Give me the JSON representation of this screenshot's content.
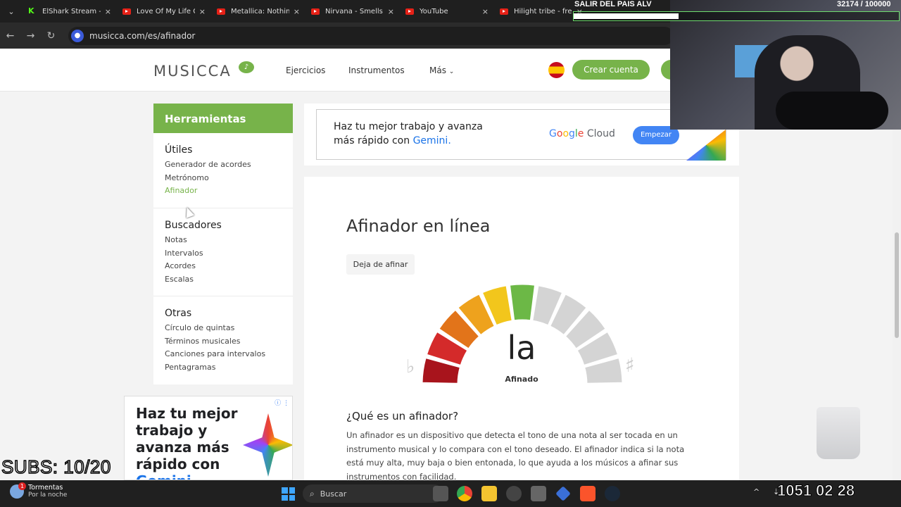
{
  "browser": {
    "tabs": [
      {
        "title": "ElShark Stream - V",
        "icon": "kick-icon"
      },
      {
        "title": "Love Of My Life G",
        "icon": "youtube-icon"
      },
      {
        "title": "Metallica: Nothing",
        "icon": "youtube-icon"
      },
      {
        "title": "Nirvana - Smells L",
        "icon": "youtube-icon"
      },
      {
        "title": "YouTube",
        "icon": "youtube-icon"
      },
      {
        "title": "Hilight tribe - free",
        "icon": "youtube-icon"
      }
    ],
    "url": "musicca.com/es/afinador"
  },
  "header": {
    "logo": "MUSICCA",
    "nav": [
      "Ejercicios",
      "Instrumentos",
      "Más"
    ],
    "create_account": "Crear cuenta"
  },
  "sidebar": {
    "title": "Herramientas",
    "sections": [
      {
        "heading": "Útiles",
        "items": [
          "Generador de acordes",
          "Metrónomo",
          "Afinador"
        ]
      },
      {
        "heading": "Buscadores",
        "items": [
          "Notas",
          "Intervalos",
          "Acordes",
          "Escalas"
        ]
      },
      {
        "heading": "Otras",
        "items": [
          "Círculo de quintas",
          "Términos musicales",
          "Canciones para intervalos",
          "Pentagramas"
        ]
      }
    ]
  },
  "ad_top": {
    "line1": "Haz tu mejor trabajo y avanza",
    "line2_prefix": "más rápido con ",
    "line2_brand": "Gemini.",
    "google_cloud": "Google Cloud",
    "cta": "Empezar"
  },
  "ad_side": {
    "text": "Haz tu mejor trabajo y avanza más rápido con",
    "brand": "Gemini"
  },
  "tuner": {
    "title": "Afinador en línea",
    "stop_button": "Deja de afinar",
    "note": "la",
    "status": "Afinado",
    "flat_symbol": "♭",
    "sharp_symbol": "♯",
    "active_segment": 5,
    "segment_colors": [
      "#a8141c",
      "#d42a2a",
      "#e2741a",
      "#eea21d",
      "#f2c61c",
      "#6cb846",
      "#d4d4d4",
      "#d4d4d4",
      "#d4d4d4",
      "#d4d4d4",
      "#d4d4d4"
    ]
  },
  "article": {
    "heading": "¿Qué es un afinador?",
    "body": "Un afinador es un dispositivo que detecta el tono de una nota al ser tocada en un instrumento musical y lo compara con el tono deseado. El afinador indica si la nota está muy alta, muy baja o bien entonada, lo que ayuda a los músicos a afinar sus instrumentos con facilidad."
  },
  "stream_overlay": {
    "goal_text": "SALIR DEL PAIS ALV",
    "goal_count": "32174  / 100000",
    "goal_progress": 0.32174,
    "subs_text": "SUBS: 10/20",
    "clock_text": "1051 02 28"
  },
  "taskbar": {
    "weather_title": "Tormentas",
    "weather_subtitle": "Por la noche",
    "weather_badge": "1",
    "search_placeholder": "Buscar"
  }
}
